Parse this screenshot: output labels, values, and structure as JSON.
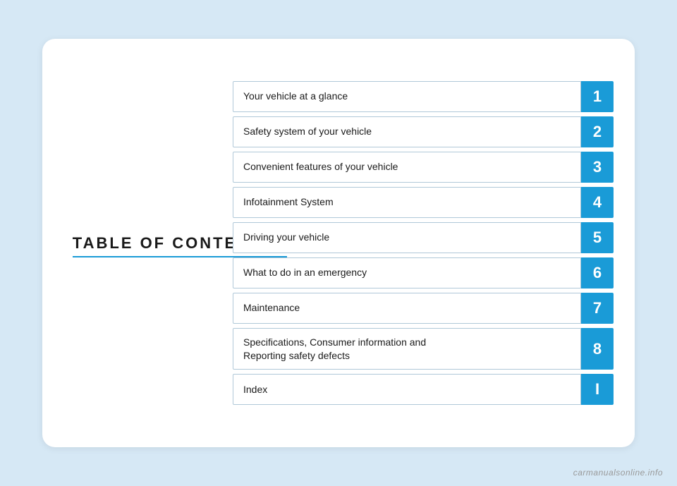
{
  "page": {
    "background_color": "#d6e8f5",
    "watermark": "carmanualsonline.info"
  },
  "toc": {
    "title": "TABLE OF CONTENTS",
    "accent_color": "#1a9bd7",
    "items": [
      {
        "id": 1,
        "label": "Your vehicle at a glance",
        "number": "1"
      },
      {
        "id": 2,
        "label": "Safety system of your vehicle",
        "number": "2"
      },
      {
        "id": 3,
        "label": "Convenient features of your vehicle",
        "number": "3"
      },
      {
        "id": 4,
        "label": "Infotainment System",
        "number": "4"
      },
      {
        "id": 5,
        "label": "Driving your vehicle",
        "number": "5"
      },
      {
        "id": 6,
        "label": "What to do in an emergency",
        "number": "6"
      },
      {
        "id": 7,
        "label": "Maintenance",
        "number": "7"
      },
      {
        "id": 8,
        "label": "Specifications, Consumer information and\nReporting safety defects",
        "number": "8"
      },
      {
        "id": 9,
        "label": "Index",
        "number": "I"
      }
    ]
  }
}
